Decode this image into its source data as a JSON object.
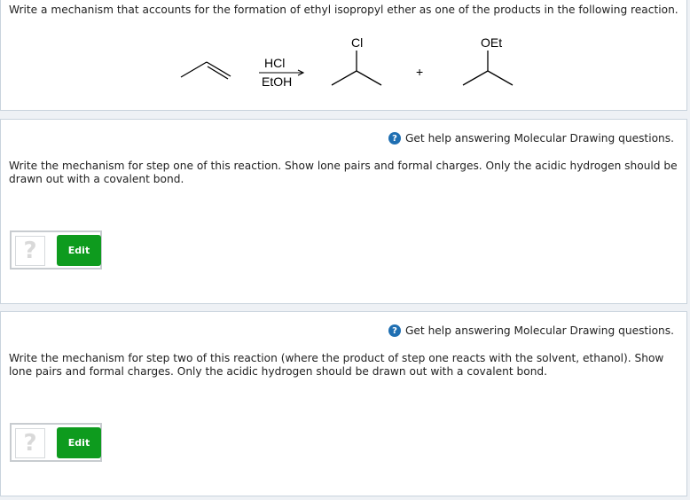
{
  "intro": {
    "text": "Write a mechanism that accounts for the formation of ethyl isopropyl ether as one of the products in the following reaction."
  },
  "reaction": {
    "reagent_top": "HCl",
    "reagent_bottom": "EtOH",
    "product1_substituent": "Cl",
    "plus": "+",
    "product2_substituent": "OEt"
  },
  "step1": {
    "help_icon": "?",
    "help_text": "Get help answering Molecular Drawing questions.",
    "instruction": "Write the mechanism for step one of this reaction. Show lone pairs and formal charges. Only the acidic hydrogen should be drawn out with a covalent bond.",
    "placeholder_glyph": "?",
    "edit_label": "Edit"
  },
  "step2": {
    "help_icon": "?",
    "help_text": "Get help answering Molecular Drawing questions.",
    "instruction": "Write the mechanism for step two of this reaction (where the product of step one reacts with the solvent, ethanol). Show lone pairs and formal charges. Only the acidic hydrogen should be drawn out with a covalent bond.",
    "placeholder_glyph": "?",
    "edit_label": "Edit"
  },
  "colors": {
    "edit_button": "#0e9b1e",
    "help_icon": "#1f6fb2",
    "panel_border": "#c9d3dd",
    "page_background": "#eef1f5"
  }
}
